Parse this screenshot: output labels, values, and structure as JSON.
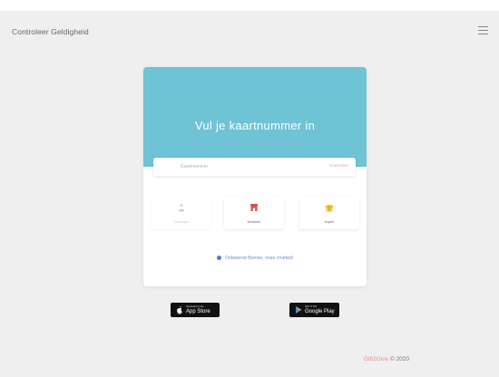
{
  "app": {
    "title": "Controleer Geldigheid"
  },
  "card": {
    "title": "Vul je kaartnummer in",
    "search": {
      "placeholder": "Kaartnummer",
      "button_label": "Controleer"
    },
    "tiles": [
      {
        "icon": "person-plant-icon",
        "label": "Ontvangen"
      },
      {
        "icon": "store-icon",
        "label": "Winkelen"
      },
      {
        "icon": "gift-icon",
        "label": "Kopen"
      }
    ],
    "help_link": "Onbekend Bonnie, onze chatbot!"
  },
  "stores": {
    "apple": {
      "small": "Download on the",
      "big": "App Store"
    },
    "google": {
      "small": "GET IT ON",
      "big": "Google Play"
    }
  },
  "footer": {
    "brand": "Gift2Give",
    "copyright": "© 2020"
  },
  "colors": {
    "header": "#6ec3d4",
    "background": "#efefef",
    "link": "#6a8fd6",
    "accent_red": "#e14b4b",
    "accent_gold": "#f0b429",
    "accent_green": "#8cc58c"
  }
}
